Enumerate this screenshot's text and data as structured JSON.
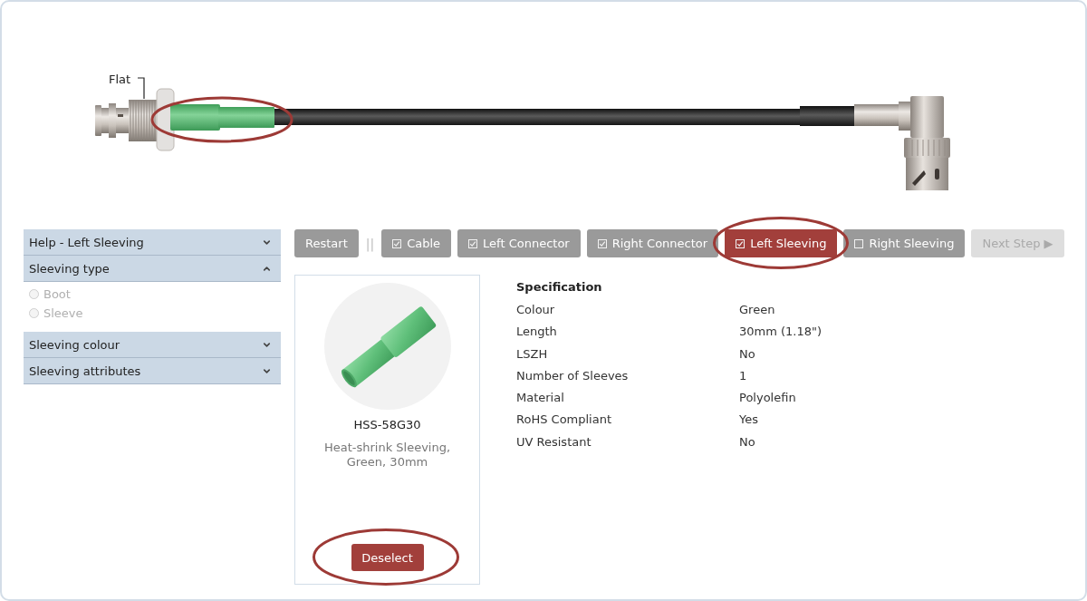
{
  "cable_preview": {
    "label": "Flat",
    "sleeve": {
      "highlighted": true
    }
  },
  "sidebar": {
    "sections": [
      {
        "title": "Help - Left Sleeving",
        "expanded": false
      },
      {
        "title": "Sleeving type",
        "expanded": true,
        "options": [
          {
            "label": "Boot",
            "selected": false,
            "disabled": true
          },
          {
            "label": "Sleeve",
            "selected": false,
            "disabled": true
          }
        ]
      },
      {
        "title": "Sleeving colour",
        "expanded": false
      },
      {
        "title": "Sleeving attributes",
        "expanded": false
      }
    ]
  },
  "toolbar": {
    "restart": "Restart",
    "separator": "||",
    "steps": [
      {
        "label": "Cable",
        "checked": true,
        "selected": false,
        "highlighted": false
      },
      {
        "label": "Left Connector",
        "checked": true,
        "selected": false,
        "highlighted": false
      },
      {
        "label": "Right Connector",
        "checked": true,
        "selected": false,
        "highlighted": false
      },
      {
        "label": "Left Sleeving",
        "checked": true,
        "selected": true,
        "highlighted": true
      },
      {
        "label": "Right Sleeving",
        "checked": false,
        "selected": false,
        "highlighted": false
      }
    ],
    "next": {
      "label": "Next Step ▶",
      "disabled": true
    }
  },
  "product": {
    "code": "HSS-58G30",
    "description": "Heat-shrink Sleeving, Green, 30mm",
    "button": {
      "label": "Deselect",
      "highlighted": true
    }
  },
  "specification": {
    "title": "Specification",
    "rows": [
      {
        "name": "Colour",
        "value": "Green"
      },
      {
        "name": "Length",
        "value": "30mm (1.18\")"
      },
      {
        "name": "LSZH",
        "value": "No"
      },
      {
        "name": "Number of Sleeves",
        "value": "1"
      },
      {
        "name": "Material",
        "value": "Polyolefin"
      },
      {
        "name": "RoHS Compliant",
        "value": "Yes"
      },
      {
        "name": "UV Resistant",
        "value": "No"
      }
    ]
  }
}
